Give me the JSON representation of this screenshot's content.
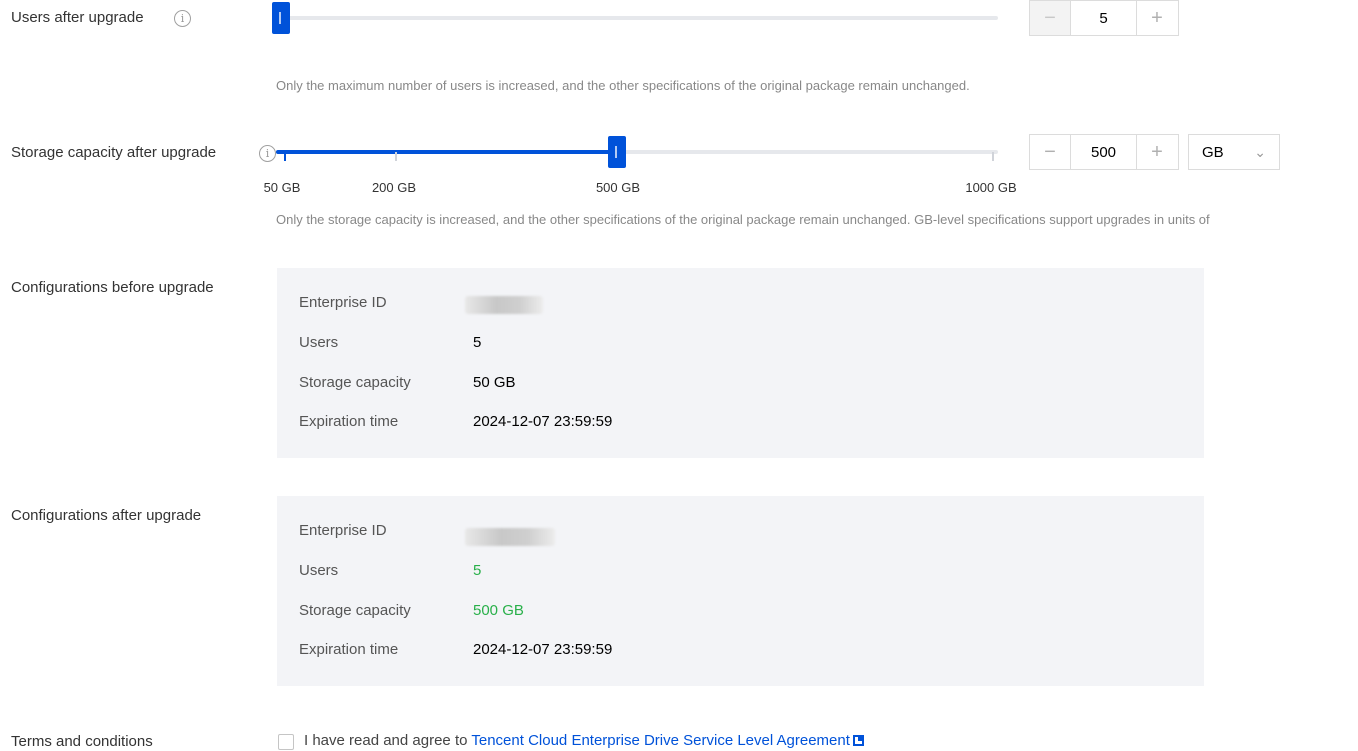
{
  "users": {
    "label": "Users after upgrade",
    "value": "5",
    "decrement": "−",
    "increment": "+",
    "hint": "Only the maximum number of users is increased, and the other specifications of the original package remain unchanged."
  },
  "storage": {
    "label": "Storage capacity after upgrade",
    "value": "500",
    "unit": "GB",
    "decrement": "−",
    "increment": "+",
    "marks": [
      "50 GB",
      "200 GB",
      "500 GB",
      "1000 GB"
    ],
    "hint": "Only the storage capacity is increased, and the other specifications of the original package remain unchanged. GB-level specifications support upgrades in units of"
  },
  "before": {
    "label": "Configurations before upgrade",
    "rows": [
      {
        "key": "Enterprise ID",
        "value": ""
      },
      {
        "key": "Users",
        "value": "5"
      },
      {
        "key": "Storage capacity",
        "value": "50 GB"
      },
      {
        "key": "Expiration time",
        "value": "2024-12-07 23:59:59"
      }
    ]
  },
  "after": {
    "label": "Configurations after upgrade",
    "rows": [
      {
        "key": "Enterprise ID",
        "value": ""
      },
      {
        "key": "Users",
        "value": "5"
      },
      {
        "key": "Storage capacity",
        "value": "500 GB"
      },
      {
        "key": "Expiration time",
        "value": "2024-12-07 23:59:59"
      }
    ]
  },
  "terms": {
    "label": "Terms and conditions",
    "text": "I have read and agree to",
    "link": "Tencent Cloud Enterprise Drive Service Level Agreement"
  },
  "colors": {
    "accent": "#0052d9",
    "highlight": "#29b04a"
  }
}
